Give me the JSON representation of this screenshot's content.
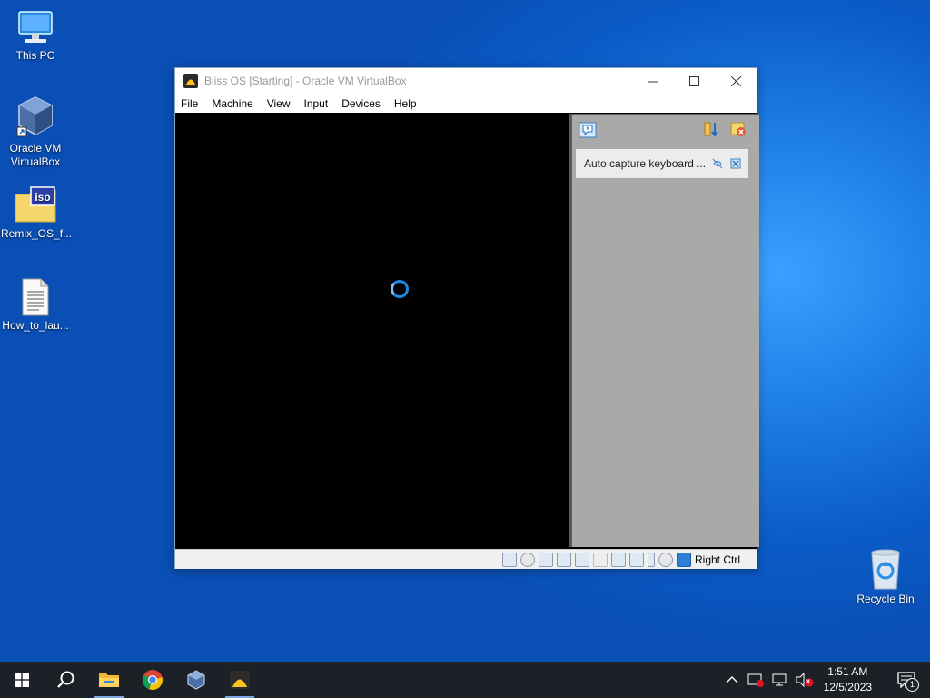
{
  "desktop": {
    "icons": [
      {
        "label": "This PC"
      },
      {
        "label": "Oracle VM VirtualBox"
      },
      {
        "label": "Remix_OS_f..."
      },
      {
        "label": "How_to_lau..."
      },
      {
        "label": "Recycle Bin"
      }
    ],
    "iso_badge": "iso"
  },
  "window": {
    "title": "Bliss OS [Starting] - Oracle VM VirtualBox",
    "menu": [
      "File",
      "Machine",
      "View",
      "Input",
      "Devices",
      "Help"
    ],
    "notification": {
      "text": "Auto capture keyboard ..."
    },
    "status": {
      "host_key": "Right Ctrl"
    }
  },
  "taskbar": {
    "clock_time": "1:51 AM",
    "clock_date": "12/5/2023",
    "notification_count": "1",
    "tray_badge": "x"
  },
  "colors": {
    "accent": "#1e88e5",
    "taskbar_bg": "#1c2027",
    "vm_screen": "#000000",
    "notif_panel": "#a9a9a9"
  }
}
